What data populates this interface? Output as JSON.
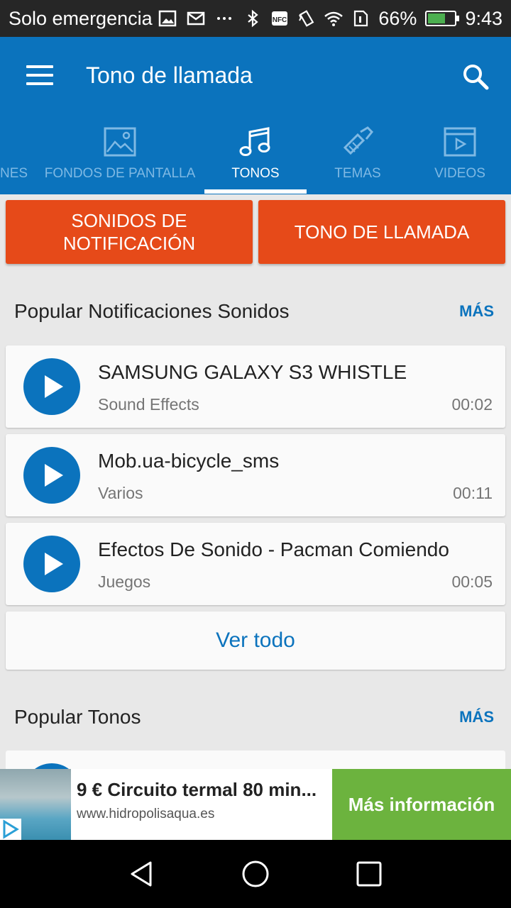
{
  "status_bar": {
    "carrier": "Solo emergencia",
    "battery_percent": "66%",
    "battery_level": 0.66,
    "time": "9:43",
    "icons": [
      "image-icon",
      "mail-icon",
      "more-dots-icon",
      "bluetooth-icon",
      "nfc-icon",
      "vibrate-icon",
      "wifi-icon",
      "sim-icon",
      "battery-icon"
    ]
  },
  "toolbar": {
    "title": "Tono de llamada"
  },
  "tabs": [
    {
      "label": "NES",
      "icon": "partial-icon"
    },
    {
      "label": "FONDOS DE PANTALLA",
      "icon": "image-icon"
    },
    {
      "label": "TONOS",
      "icon": "music-note-icon",
      "active": true
    },
    {
      "label": "TEMAS",
      "icon": "paintbrush-icon"
    },
    {
      "label": "VIDEOS",
      "icon": "video-icon"
    }
  ],
  "category_buttons": {
    "notifications": "SONIDOS DE NOTIFICACIÓN",
    "ringtone": "TONO DE LLAMADA"
  },
  "notifications_section": {
    "title": "Popular Notificaciones Sonidos",
    "more": "MÁS",
    "items": [
      {
        "title": "SAMSUNG GALAXY S3 WHISTLE",
        "category": "Sound Effects",
        "duration": "00:02"
      },
      {
        "title": "Mob.ua-bicycle_sms",
        "category": "Varios",
        "duration": "00:11"
      },
      {
        "title": "Efectos De Sonido - Pacman Comiendo",
        "category": "Juegos",
        "duration": "00:05"
      }
    ],
    "see_all": "Ver todo"
  },
  "ringtones_section": {
    "title": "Popular Tonos",
    "more": "MÁS"
  },
  "ad": {
    "title": "9 € Circuito termal 80 min...",
    "url": "www.hidropolisaqua.es",
    "cta": "Más información"
  },
  "colors": {
    "primary": "#0b73bd",
    "accent": "#e64a19",
    "cta_green": "#6cb33e",
    "background": "#e8e8e8"
  }
}
